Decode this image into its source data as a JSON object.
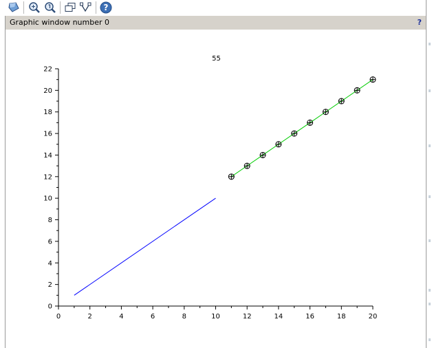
{
  "toolbar": {
    "buttons": [
      {
        "name": "rotate-tool-button",
        "icon": "rotate-3d-icon"
      },
      {
        "name": "zoom-button",
        "icon": "zoom-icon"
      },
      {
        "name": "unzoom-button",
        "icon": "unzoom-icon"
      },
      {
        "name": "windows-button",
        "icon": "windows-icon"
      },
      {
        "name": "datatip-button",
        "icon": "datatip-icon"
      },
      {
        "name": "help-button",
        "icon": "help-icon"
      }
    ]
  },
  "window": {
    "title": "Graphic window number 0",
    "help_label": "?"
  },
  "chart_data": {
    "type": "line",
    "title": "55",
    "xlabel": "",
    "ylabel": "",
    "xlim": [
      0,
      20
    ],
    "ylim": [
      0,
      22
    ],
    "xticks": [
      0,
      2,
      4,
      6,
      8,
      10,
      12,
      14,
      16,
      18,
      20
    ],
    "yticks": [
      0,
      2,
      4,
      6,
      8,
      10,
      12,
      14,
      16,
      18,
      20,
      22
    ],
    "grid": false,
    "series": [
      {
        "x": [
          1,
          10
        ],
        "y": [
          1,
          10
        ],
        "color": "#0000ff",
        "marker": "none"
      },
      {
        "x": [
          11,
          12,
          13,
          14,
          15,
          16,
          17,
          18,
          19,
          20
        ],
        "y": [
          12,
          13,
          14,
          15,
          16,
          17,
          18,
          19,
          20,
          21
        ],
        "color": "#00cc00",
        "marker": "circle-plus"
      }
    ]
  }
}
